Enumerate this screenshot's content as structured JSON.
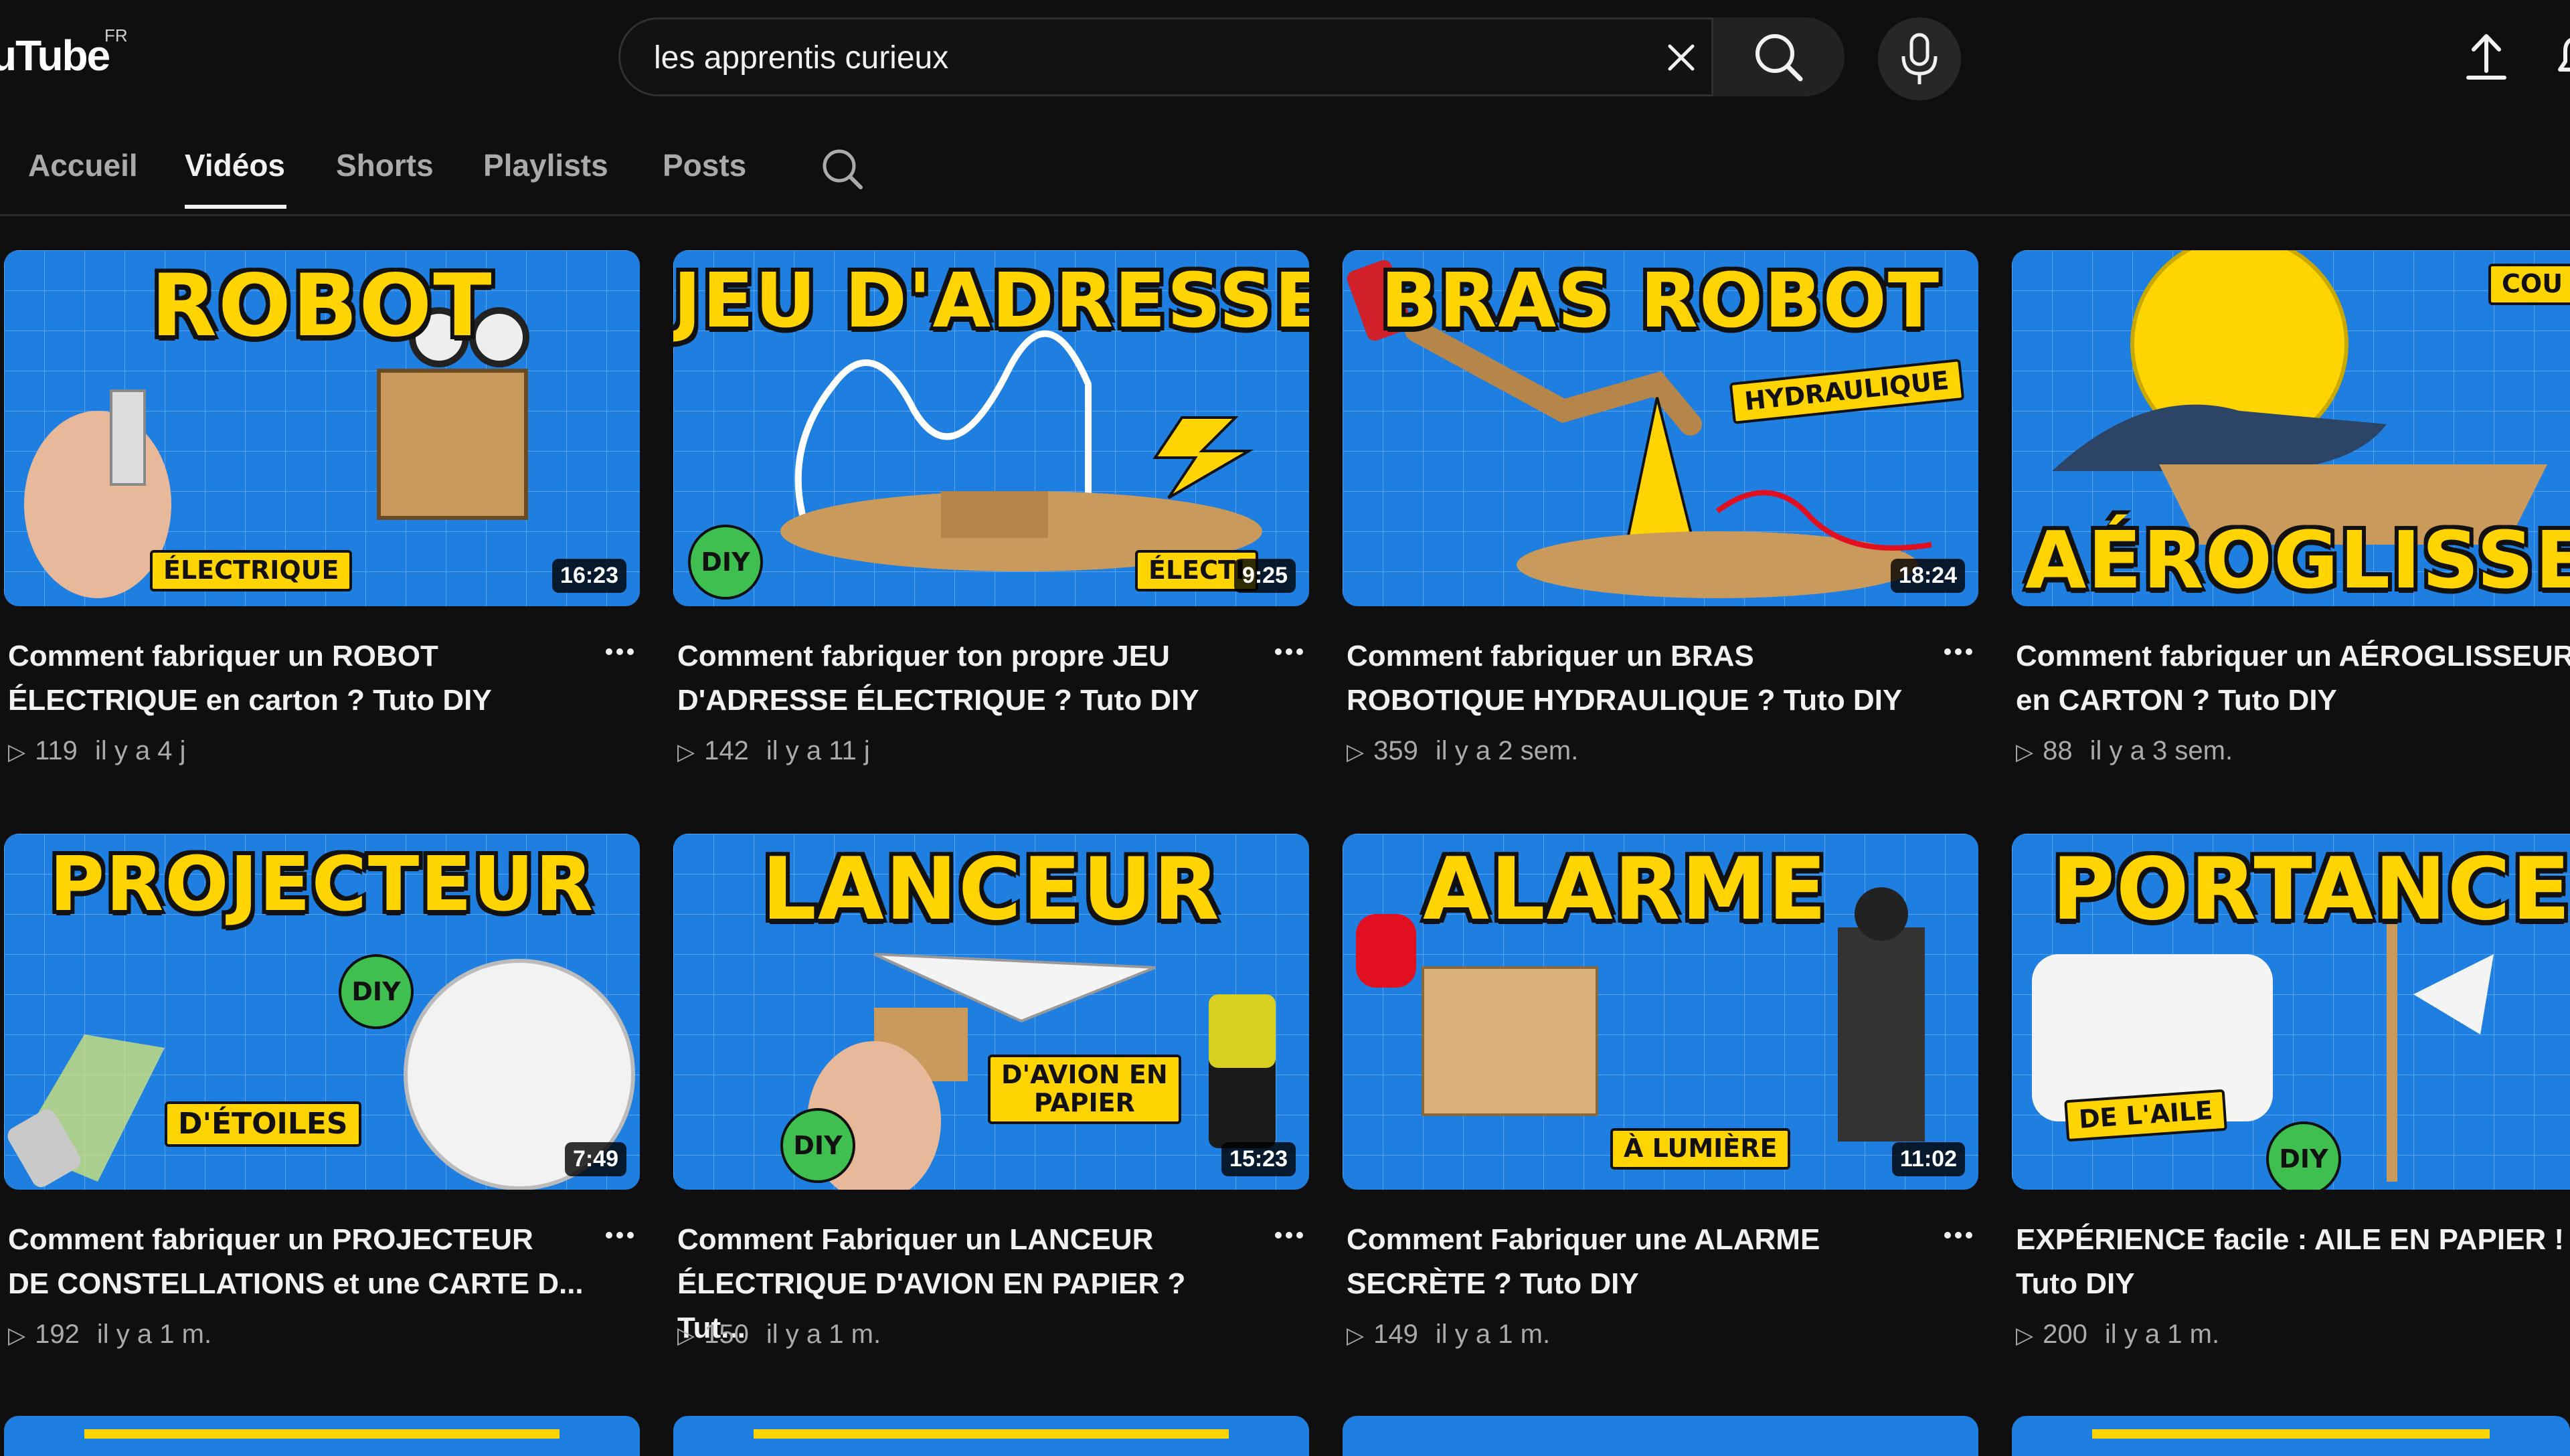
{
  "header": {
    "logo_text": "uTube",
    "country_code": "FR",
    "search_value": "les apprentis curieux"
  },
  "tabs": [
    {
      "label": "Accueil"
    },
    {
      "label": "Vidéos"
    },
    {
      "label": "Shorts"
    },
    {
      "label": "Playlists"
    },
    {
      "label": "Posts"
    }
  ],
  "videos": [
    {
      "thumb_title": "ROBOT",
      "tag": "ÉLECTRIQUE",
      "duration": "16:23",
      "title": "Comment fabriquer un ROBOT\nÉLECTRIQUE en carton ? Tuto DIY",
      "views": "119",
      "age": "il y a 4 j"
    },
    {
      "thumb_title": "JEU D'ADRESSE",
      "tag": "ÉLECTI",
      "duration": "9:25",
      "badge": "DIY",
      "title": "Comment fabriquer ton propre JEU\nD'ADRESSE ÉLECTRIQUE ? Tuto DIY",
      "views": "142",
      "age": "il y a 11 j"
    },
    {
      "thumb_title": "BRAS ROBOT",
      "tag": "HYDRAULIQUE",
      "duration": "18:24",
      "title": "Comment fabriquer un BRAS\nROBOTIQUE HYDRAULIQUE ? Tuto DIY",
      "views": "359",
      "age": "il y a 2 sem."
    },
    {
      "thumb_title": "AÉROGLISSEU",
      "tag": "COU",
      "title": "Comment fabriquer un AÉROGLISSEUR\nen CARTON ? Tuto DIY",
      "views": "88",
      "age": "il y a 3 sem."
    },
    {
      "thumb_title": "PROJECTEUR",
      "tag": "D'ÉTOILES",
      "duration": "7:49",
      "badge": "DIY",
      "title": "Comment fabriquer un PROJECTEUR\nDE CONSTELLATIONS et une CARTE D...",
      "views": "192",
      "age": "il y a 1 m."
    },
    {
      "thumb_title": "LANCEUR",
      "tag": "D'AVION EN\nPAPIER",
      "duration": "15:23",
      "badge": "DIY",
      "title": "Comment Fabriquer un LANCEUR\nÉLECTRIQUE D'AVION EN PAPIER ? Tut...",
      "views": "150",
      "age": "il y a 1 m."
    },
    {
      "thumb_title": "ALARME",
      "tag": "À LUMIÈRE",
      "duration": "11:02",
      "title": "Comment Fabriquer une ALARME\nSECRÈTE ? Tuto DIY",
      "views": "149",
      "age": "il y a 1 m."
    },
    {
      "thumb_title": "PORTANCE",
      "tag": "DE L'AILE",
      "badge": "DIY",
      "title": "EXPÉRIENCE facile : AILE EN PAPIER !\nTuto DIY",
      "views": "200",
      "age": "il y a 1 m."
    }
  ],
  "colors": {
    "background": "#0f0f0f",
    "thumb_blue": "#1e7fe0",
    "thumb_yellow": "#ffd400",
    "diy_green": "#3fbf4f"
  },
  "icons": [
    "clear-icon",
    "search-icon",
    "mic-icon",
    "upload-icon",
    "bell-icon",
    "more-vert-icon",
    "play-icon"
  ]
}
